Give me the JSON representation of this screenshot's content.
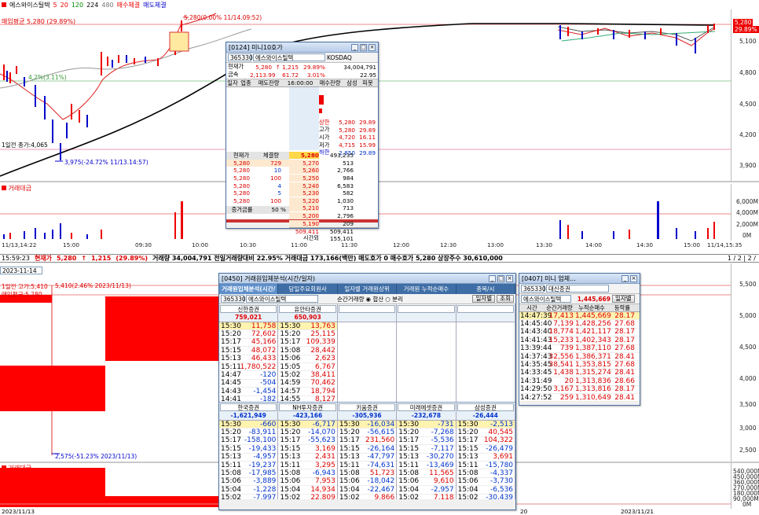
{
  "top_bar": {
    "name": "에스와이스틸텍",
    "ma_items": [
      "5",
      "20",
      "120",
      "224",
      "480"
    ],
    "buy_label": "매수체결",
    "sell_label": "매도체결"
  },
  "top_labels": {
    "avg_price": "매입평균 5,280 (29.89%)",
    "high_note": "5,280(0.00% 11/14.09:52)",
    "low_note": "3,975(-24.72% 11/13.14:57)",
    "prev_close": "1일전 종가:4,065",
    "ma_note": "4,2%(3.11%)"
  },
  "upper_axis": [
    "5,100",
    "4,800",
    "4,500",
    "4,200",
    "3,900"
  ],
  "price_tag": {
    "a": "5,280",
    "b": "29.89%"
  },
  "vol_label": "거래대금",
  "vol_axis": [
    "6,000M",
    "4,000M",
    "2,000M",
    "0M"
  ],
  "time_axis": [
    "11/13,14:22",
    "15:00",
    "09:30",
    "10:00",
    "10:30",
    "11:00",
    "11:30",
    "12:00",
    "12:30",
    "13:00",
    "13:30",
    "14:00",
    "14:30",
    "15:00",
    "11/14,15:35"
  ],
  "status": {
    "time": "15:59:23",
    "label": "현재가",
    "price": "5,280",
    "arrow": "↑",
    "change": "1,215",
    "rate": "(29.89%)",
    "rest": "거래량 34,004,791  전일거래량대비 22.95%  거래대금 173,166(백만)  매도호가 0  매수호가 5,280  상장주수 30,610,000",
    "page": "1 / 2 | 2 /"
  },
  "lower_labels": {
    "high": "1일전 고가:5,410",
    "high_note": "5,410(2.46% 2023/11/13)",
    "avg": "매입평균:5,280",
    "low_note": "2,575(-51.23% 2023/11/13)",
    "period": "2023-11-14",
    "vol_label": "거래대금"
  },
  "lower_axis": [
    "5,500",
    "5,000",
    "4,500",
    "4,000",
    "3,500",
    "3,000",
    "2,500"
  ],
  "lower_vol_axis": [
    "540,000M",
    "450,000M",
    "360,000M",
    "270,000M",
    "180,000M",
    "90,000M",
    "0M"
  ],
  "lower_dates": [
    "2023/11/13",
    "20",
    "2023/11/21"
  ],
  "orderbook": {
    "title": "[0124] 미니10호가",
    "code": "365330",
    "name": "에스와이스틸텍",
    "market": "KOSDAQ",
    "cur_label": "현재가",
    "cur": "5,280",
    "chg": "↑ 1,215",
    "rate": "29.89%",
    "vol": "34,004,791",
    "idx_label": "금속",
    "idx": "2,113.99",
    "idx_chg": "61.72",
    "idx_rate": "3.01%",
    "idx_vol": "22.95",
    "hdr": [
      "일자",
      "업종",
      "매도잔량",
      "16:00:00",
      "매수잔량",
      "삼성",
      "피봇"
    ],
    "info": [
      [
        "상한",
        "5,280",
        "29.89"
      ],
      [
        "고가",
        "5,280",
        "29.89"
      ],
      [
        "시가",
        "4,720",
        "16.11"
      ],
      [
        "저가",
        "4,715",
        "15.99"
      ],
      [
        "하한",
        "2,850",
        "29.89"
      ]
    ],
    "tick_hdr": [
      "현재가",
      "체결량"
    ],
    "ticks": [
      [
        "5,280",
        "729"
      ],
      [
        "5,280",
        "10"
      ],
      [
        "5,280",
        "100"
      ],
      [
        "5,280",
        "4"
      ],
      [
        "5,280",
        "5"
      ],
      [
        "5,280",
        "100"
      ]
    ],
    "bids": [
      [
        "5,280",
        "493,235"
      ],
      [
        "5,270",
        "513"
      ],
      [
        "5,260",
        "2,766"
      ],
      [
        "5,250",
        "984"
      ],
      [
        "5,240",
        "6,583"
      ],
      [
        "5,230",
        "582"
      ],
      [
        "5,220",
        "1,030"
      ],
      [
        "5,210",
        "713"
      ],
      [
        "5,200",
        "2,796"
      ],
      [
        "5,190",
        "209"
      ]
    ],
    "tot_left": "509,411",
    "tot_right": "509,411",
    "tot_label": "시간외",
    "tot_after": "155,101",
    "incr_label": "증거금률",
    "incr_val": "50 %"
  },
  "broker": {
    "title": "[0450] 거래원입체분석(시간/일자)",
    "tabs": [
      "거래원입체분석(시간/일자)",
      "당일주요회원사",
      "일자별 거래원상위",
      "거래원 누적순매수",
      "종목/시"
    ],
    "code": "365330",
    "name": "에스와이스틸텍",
    "label_mode": "순간거래량",
    "opt1": "합산",
    "opt2": "분리",
    "btn_daily": "일자별",
    "btn_query": "조회",
    "top_boxes": [
      {
        "name": "신한증권",
        "total": "759,021",
        "rows": [
          [
            "15:30",
            "11,758"
          ],
          [
            "15:20",
            "72,602"
          ],
          [
            "15:17",
            "45,166"
          ],
          [
            "15:15",
            "48,072"
          ],
          [
            "15:13",
            "46,433"
          ],
          [
            "15:11",
            "1,780,522"
          ],
          [
            "14:47",
            "-120"
          ],
          [
            "14:45",
            "-504"
          ],
          [
            "14:43",
            "-1,454"
          ],
          [
            "14:41",
            "-182"
          ]
        ]
      },
      {
        "name": "유안타증권",
        "total": "650,903",
        "rows": [
          [
            "15:30",
            "13,763"
          ],
          [
            "15:20",
            "25,115"
          ],
          [
            "15:17",
            "109,339"
          ],
          [
            "15:08",
            "28,442"
          ],
          [
            "15:06",
            "2,623"
          ],
          [
            "15:05",
            "6,767"
          ],
          [
            "15:02",
            "38,411"
          ],
          [
            "14:59",
            "70,462"
          ],
          [
            "14:57",
            "18,794"
          ],
          [
            "14:55",
            "8,127"
          ]
        ]
      },
      {
        "name": "",
        "total": "",
        "rows": []
      },
      {
        "name": "",
        "total": "",
        "rows": []
      },
      {
        "name": "",
        "total": "",
        "rows": []
      }
    ],
    "bottom_boxes": [
      {
        "name": "한국증권",
        "total": "-1,621,949",
        "rows": [
          [
            "15:30",
            "-660"
          ],
          [
            "15:20",
            "-83,911"
          ],
          [
            "15:17",
            "-158,100"
          ],
          [
            "15:15",
            "-19,433"
          ],
          [
            "15:13",
            "-4,957"
          ],
          [
            "15:11",
            "-19,237"
          ],
          [
            "15:08",
            "-17,985"
          ],
          [
            "15:06",
            "-3,889"
          ],
          [
            "15:04",
            "-1,228"
          ],
          [
            "15:02",
            "-7,997"
          ]
        ]
      },
      {
        "name": "NH투자증권",
        "total": "-423,166",
        "rows": [
          [
            "15:30",
            "-6,717"
          ],
          [
            "15:20",
            "-14,070"
          ],
          [
            "15:17",
            "-55,623"
          ],
          [
            "15:15",
            "3,169"
          ],
          [
            "15:13",
            "2,431"
          ],
          [
            "15:11",
            "3,295"
          ],
          [
            "15:08",
            "-6,943"
          ],
          [
            "15:06",
            "7,953"
          ],
          [
            "15:04",
            "14,934"
          ],
          [
            "15:02",
            "22,809"
          ]
        ]
      },
      {
        "name": "키움증권",
        "total": "-305,936",
        "rows": [
          [
            "15:30",
            "-16,034"
          ],
          [
            "15:20",
            "-56,615"
          ],
          [
            "15:17",
            "231,560"
          ],
          [
            "15:15",
            "-26,164"
          ],
          [
            "15:13",
            "-47,797"
          ],
          [
            "15:11",
            "-74,631"
          ],
          [
            "15:08",
            "51,723"
          ],
          [
            "15:06",
            "-18,042"
          ],
          [
            "15:04",
            "-22,467"
          ],
          [
            "15:02",
            "9,866"
          ]
        ]
      },
      {
        "name": "미래에셋증권",
        "total": "-232,678",
        "rows": [
          [
            "15:30",
            "-731"
          ],
          [
            "15:20",
            "-7,268"
          ],
          [
            "15:17",
            "-5,536"
          ],
          [
            "15:15",
            "-7,117"
          ],
          [
            "15:13",
            "-30,270"
          ],
          [
            "15:11",
            "-13,469"
          ],
          [
            "15:08",
            "11,565"
          ],
          [
            "15:06",
            "9,610"
          ],
          [
            "15:04",
            "-2,957"
          ],
          [
            "15:02",
            "7,118"
          ]
        ]
      },
      {
        "name": "삼성증권",
        "total": "-26,444",
        "rows": [
          [
            "15:30",
            "-2,513"
          ],
          [
            "15:20",
            "40,545"
          ],
          [
            "15:17",
            "104,322"
          ],
          [
            "15:15",
            "-26,479"
          ],
          [
            "15:13",
            "3,691"
          ],
          [
            "15:11",
            "-15,780"
          ],
          [
            "15:08",
            "-4,337"
          ],
          [
            "15:06",
            "-3,730"
          ],
          [
            "15:04",
            "-6,536"
          ],
          [
            "15:02",
            "-30,439"
          ]
        ]
      }
    ]
  },
  "daishin": {
    "title": "[0407] 미니 업체...",
    "code": "365330",
    "broker": "대신증권",
    "name": "에스와이스틸텍",
    "total": "1,445,669",
    "btn": "일자별",
    "hdr": [
      "시간",
      "순간거래량",
      "누적순매수",
      "등락률"
    ],
    "rows": [
      [
        "14:47:39",
        "17,413",
        "1,445,669",
        "28.17"
      ],
      [
        "14:45:40",
        "7,139",
        "1,428,256",
        "27.68"
      ],
      [
        "14:43:40",
        "18,774",
        "1,421,117",
        "28.17"
      ],
      [
        "14:41:43",
        "15,233",
        "1,402,343",
        "28.17"
      ],
      [
        "13:39:44",
        "739",
        "1,387,110",
        "27.68"
      ],
      [
        "14:37:43",
        "32,556",
        "1,386,371",
        "28.41"
      ],
      [
        "14:35:45",
        "38,541",
        "1,353,815",
        "27.68"
      ],
      [
        "14:33:45",
        "1,438",
        "1,315,274",
        "28.41"
      ],
      [
        "14:31:49",
        "20",
        "1,313,836",
        "28.66"
      ],
      [
        "14:29:50",
        "3,167",
        "1,313,816",
        "28.17"
      ],
      [
        "14:27:52",
        "259",
        "1,310,649",
        "28.41"
      ]
    ]
  }
}
